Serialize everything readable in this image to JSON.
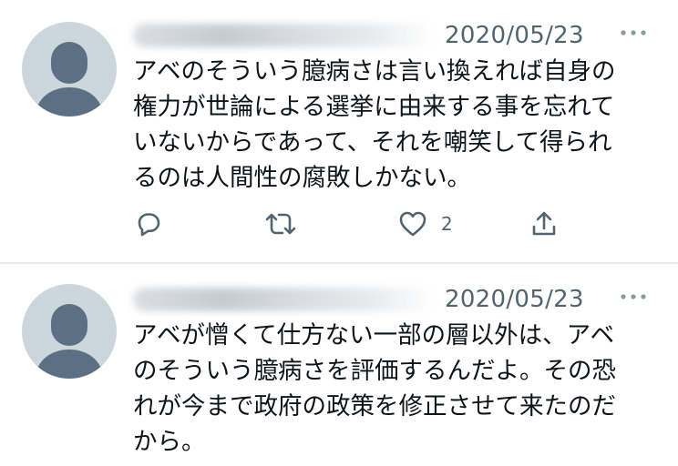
{
  "tweets": [
    {
      "date": "2020/05/23",
      "text": "アベのそういう臆病さは言い換えれば自身の\n権力が世論による選挙に由来する事を忘れて\nいないからであって、それを嘲笑して得られ\nるのは人間性の腐敗しかない。",
      "like_count": "2",
      "icons": {
        "avatar": "default-avatar-icon",
        "more": "more-horizontal-icon",
        "reply": "reply-icon",
        "retweet": "retweet-icon",
        "like": "heart-icon",
        "share": "share-icon"
      }
    },
    {
      "date": "2020/05/23",
      "text": "アベが憎くて仕方ない一部の層以外は、アベ\nのそういう臆病さを評価するんだよ。その恐\nれが今まで政府の政策を修正させて来たのだ\nから。",
      "icons": {
        "avatar": "default-avatar-icon",
        "more": "more-horizontal-icon"
      }
    }
  ],
  "colors": {
    "text": "#0f1419",
    "secondary_text": "#536471",
    "avatar_bg": "#ccd6dd",
    "avatar_figure": "#5b7083",
    "divider": "#e6ecf0"
  }
}
